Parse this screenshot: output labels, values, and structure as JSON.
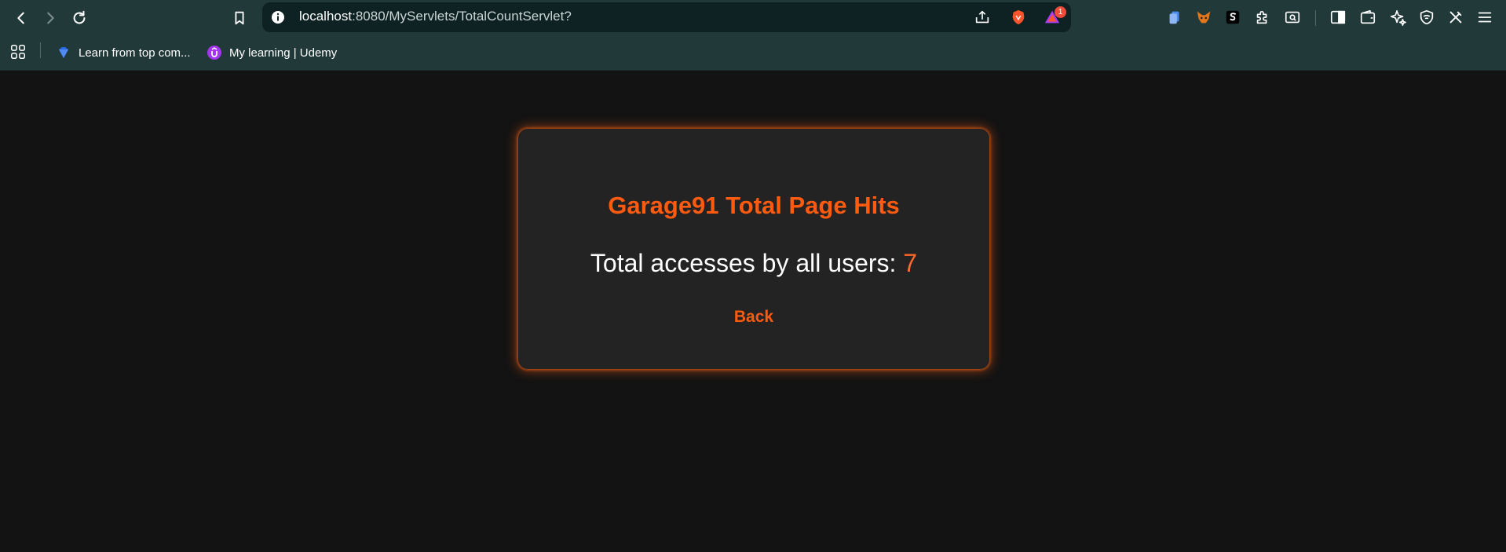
{
  "browser": {
    "url_host": "localhost",
    "url_rest": ":8080/MyServlets/TotalCountServlet?",
    "notification_count": "1",
    "bookmarks": [
      {
        "label": "Learn from top com...",
        "icon": "diamond-icon"
      },
      {
        "label": "My learning | Udemy",
        "icon": "udemy-icon"
      }
    ]
  },
  "page": {
    "title": "Garage91 Total Page Hits",
    "accesses_label": "Total accesses by all users: ",
    "accesses_count": "7",
    "back_label": "Back"
  },
  "colors": {
    "accent": "#fe5a10",
    "background": "#131313",
    "card": "#232323",
    "chrome": "#22393a"
  }
}
